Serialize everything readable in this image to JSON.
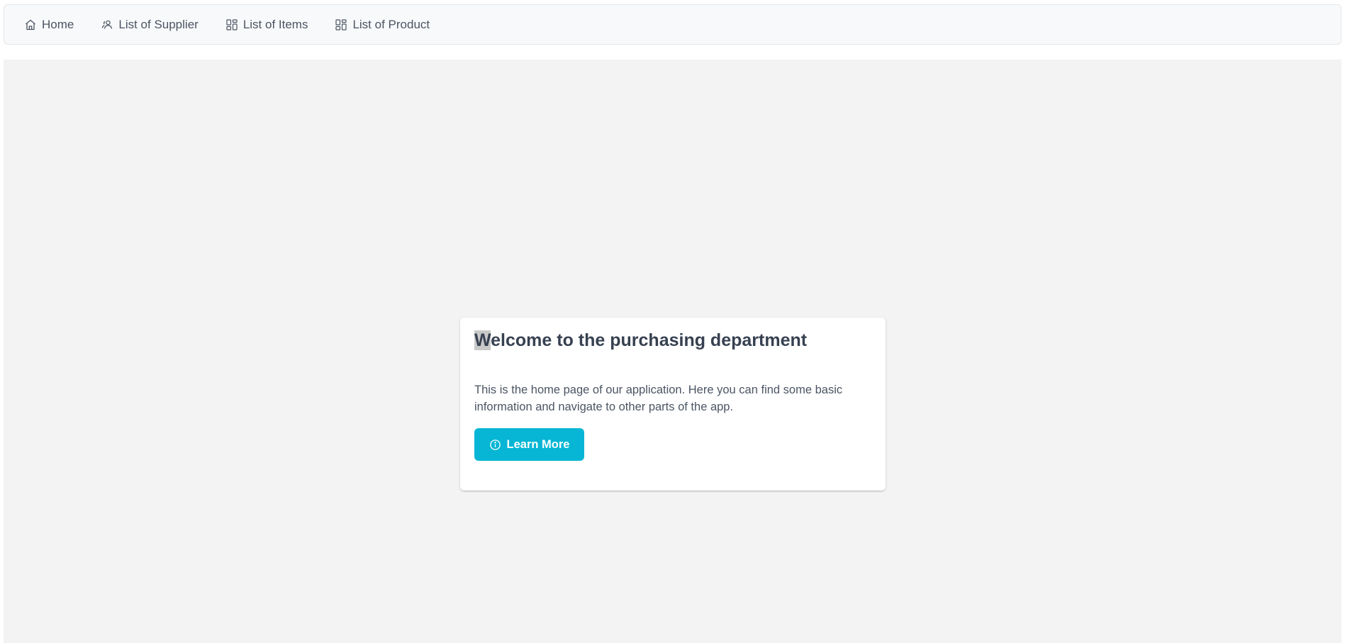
{
  "menubar": {
    "items": [
      {
        "label": "Home",
        "icon": "home-icon"
      },
      {
        "label": "List of Supplier",
        "icon": "users-icon"
      },
      {
        "label": "List of Items",
        "icon": "th-large-icon"
      },
      {
        "label": "List of Product",
        "icon": "th-large-icon"
      }
    ]
  },
  "card": {
    "title_first": "W",
    "title_rest": "elcome to the purchasing department",
    "text": "This is the home page of our application. Here you can find some basic information and navigate to other parts of the app.",
    "button_label": "Learn More",
    "button_icon": "info-circle-icon"
  },
  "colors": {
    "accent": "#06b6d4",
    "background": "#f3f3f3",
    "menubar_bg": "#f8f9fa",
    "text": "#4b5563"
  }
}
